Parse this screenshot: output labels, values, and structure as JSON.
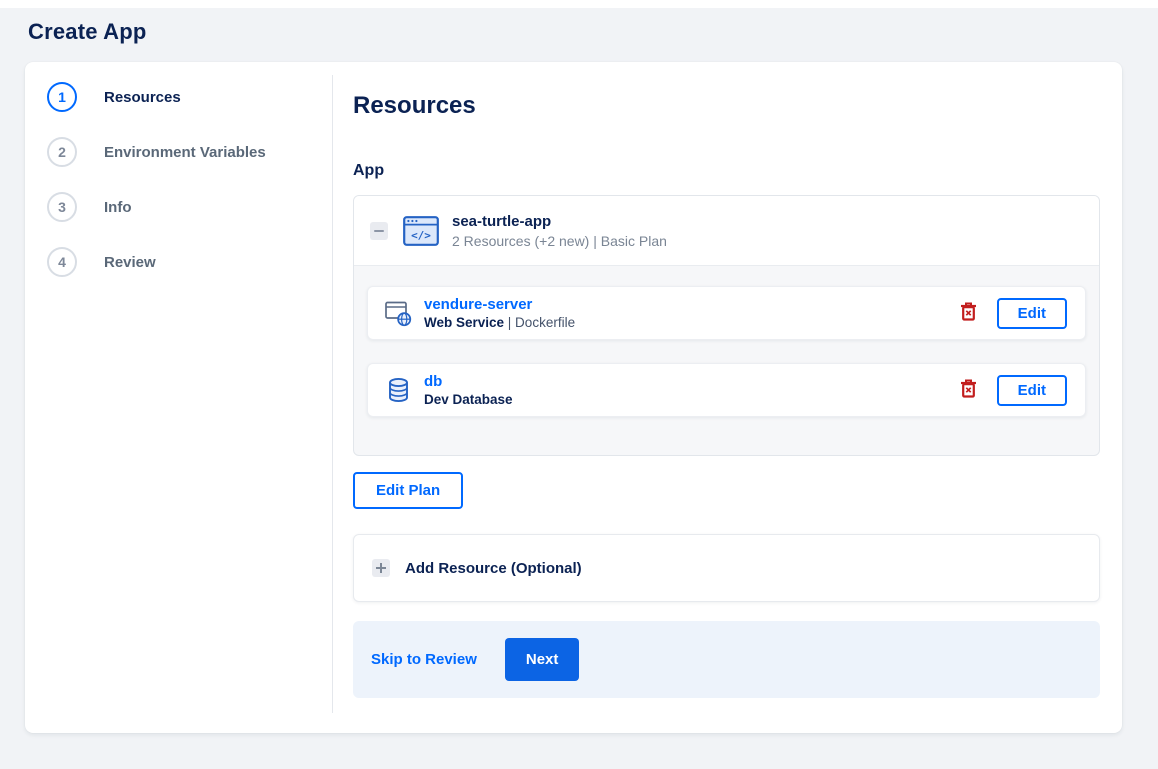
{
  "page": {
    "title": "Create App"
  },
  "steps": [
    {
      "number": "1",
      "label": "Resources"
    },
    {
      "number": "2",
      "label": "Environment Variables"
    },
    {
      "number": "3",
      "label": "Info"
    },
    {
      "number": "4",
      "label": "Review"
    }
  ],
  "main": {
    "heading": "Resources",
    "section_label": "App",
    "app": {
      "name": "sea-turtle-app",
      "summary": "2 Resources (+2 new) | Basic Plan",
      "resources": [
        {
          "name": "vendure-server",
          "type": "Web Service",
          "detail": " | Dockerfile",
          "edit_label": "Edit"
        },
        {
          "name": "db",
          "type": "Dev Database",
          "detail": "",
          "edit_label": "Edit"
        }
      ]
    },
    "edit_plan_label": "Edit Plan",
    "add_resource_label": "Add Resource (Optional)",
    "footer": {
      "skip_label": "Skip to Review",
      "next_label": "Next"
    }
  },
  "colors": {
    "accent_blue": "#0069ff",
    "button_blue": "#0c64e4",
    "heading_navy": "#0b2253",
    "danger_red": "#c21e1e",
    "page_background": "#f1f3f6",
    "footer_background": "#edf3fb"
  }
}
